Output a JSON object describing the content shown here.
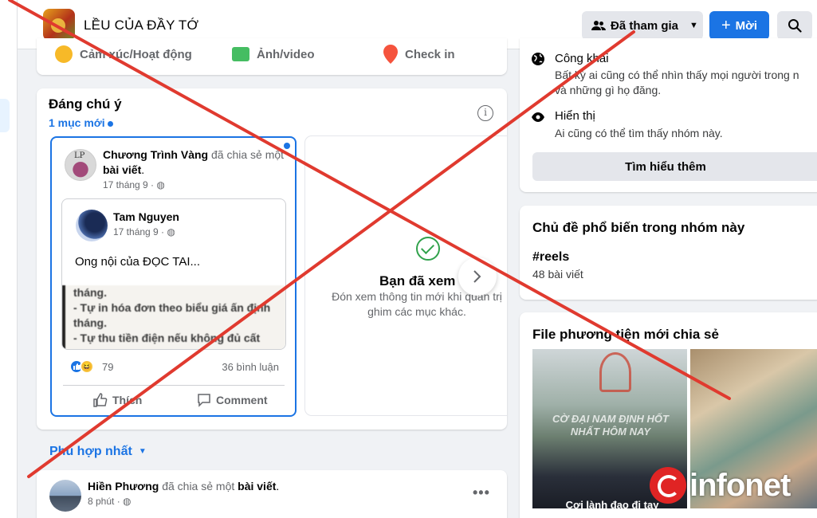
{
  "group": {
    "name": "LỀU CỦA ĐẦY TỚ"
  },
  "header": {
    "joined_label": "Đã tham gia",
    "invite_label": "Mời"
  },
  "composer": {
    "feeling": "Cảm xúc/Hoạt động",
    "photo": "Ảnh/video",
    "checkin": "Check in"
  },
  "featured": {
    "title": "Đáng chú ý",
    "new_count": "1 mục mới",
    "post": {
      "author": "Chương Trình Vàng",
      "action": "đã chia sẻ một",
      "object": "bài viết",
      "time": "17 tháng 9 ·",
      "inner": {
        "author": "Tam Nguyen",
        "time": "17 tháng 9 ·",
        "text": "Ong nội của ĐỌC TAI...",
        "image_lines": [
          "tháng.",
          "- Tự in hóa đơn theo biểu giá ấn định",
          "tháng.",
          "- Tự thu tiền điện nếu không đủ cất"
        ]
      },
      "reaction_count": "79",
      "comment_count": "36 bình luận",
      "like_label": "Thích",
      "comment_label": "Comment"
    },
    "seen": {
      "title": "Bạn đã xem",
      "desc": "Đón xem thông tin mới khi quản trị ghim các mục khác."
    }
  },
  "feed": {
    "sort_label": "Phù hợp nhất",
    "post": {
      "author": "Hiền Phương",
      "action": "đã chia sẻ một",
      "object": "bài viết",
      "time": "8 phút ·"
    }
  },
  "about": {
    "public_title": "Công khai",
    "public_desc_1": "Bất kỳ ai cũng có thể nhìn thấy mọi người trong n",
    "public_desc_2": "và những gì họ đăng.",
    "visible_title": "Hiển thị",
    "visible_desc": "Ai cũng có thể tìm thấy nhóm này.",
    "learn_more": "Tìm hiểu thêm"
  },
  "topics": {
    "title": "Chủ đề phổ biến trong nhóm này",
    "tag": "#reels",
    "count": "48 bài viết"
  },
  "media": {
    "title": "File phương tiện mới chia sẻ",
    "caption_1": "CỜ ĐẠI NAM ĐỊNH HỐT NHẤT HÔM NAY",
    "caption_2": "Cơi lành đạo đi tay"
  },
  "watermark": {
    "text": "infonet"
  },
  "colors": {
    "accent": "#1b74e4",
    "cross": "#e03a2f",
    "bg": "#f0f2f5"
  },
  "icons": [
    "people-icon",
    "plus-icon",
    "search-icon",
    "info-icon",
    "check-circle-icon",
    "chevron-right-icon",
    "globe-icon",
    "eye-icon",
    "like-icon",
    "comment-icon",
    "more-icon"
  ]
}
